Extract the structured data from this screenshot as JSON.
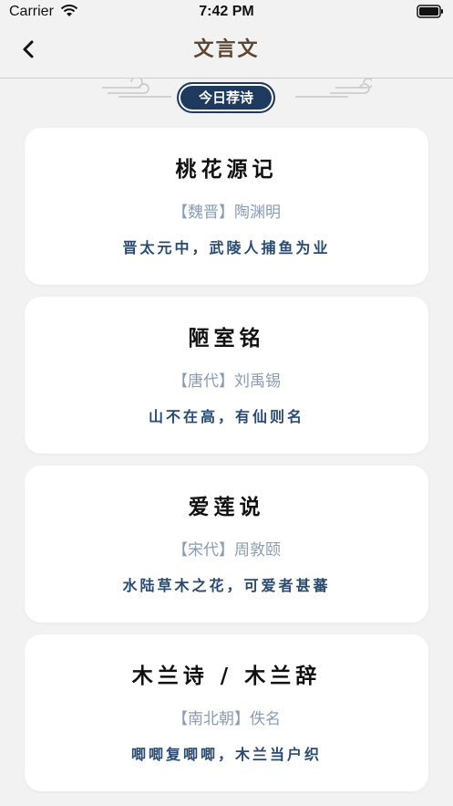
{
  "status_bar": {
    "carrier": "Carrier",
    "time": "7:42 PM"
  },
  "nav": {
    "title": "文言文"
  },
  "banner": {
    "label": "今日荐诗"
  },
  "poems": [
    {
      "title": "桃花源记",
      "dynasty": "【魏晋】",
      "author": "陶渊明",
      "line": "晋太元中，武陵人捕鱼为业"
    },
    {
      "title": "陋室铭",
      "dynasty": "【唐代】",
      "author": "刘禹锡",
      "line": "山不在高，有仙则名"
    },
    {
      "title": "爱莲说",
      "dynasty": "【宋代】",
      "author": "周敦颐",
      "line": "水陆草木之花，可爱者甚蕃"
    },
    {
      "title": "木兰诗 / 木兰辞",
      "dynasty": "【南北朝】",
      "author": "佚名",
      "line": "唧唧复唧唧，木兰当户织"
    }
  ],
  "colors": {
    "accent": "#1f3a5f",
    "title_brown": "#5a4632",
    "meta": "#8a9bb2",
    "line": "#2b4a6f"
  }
}
